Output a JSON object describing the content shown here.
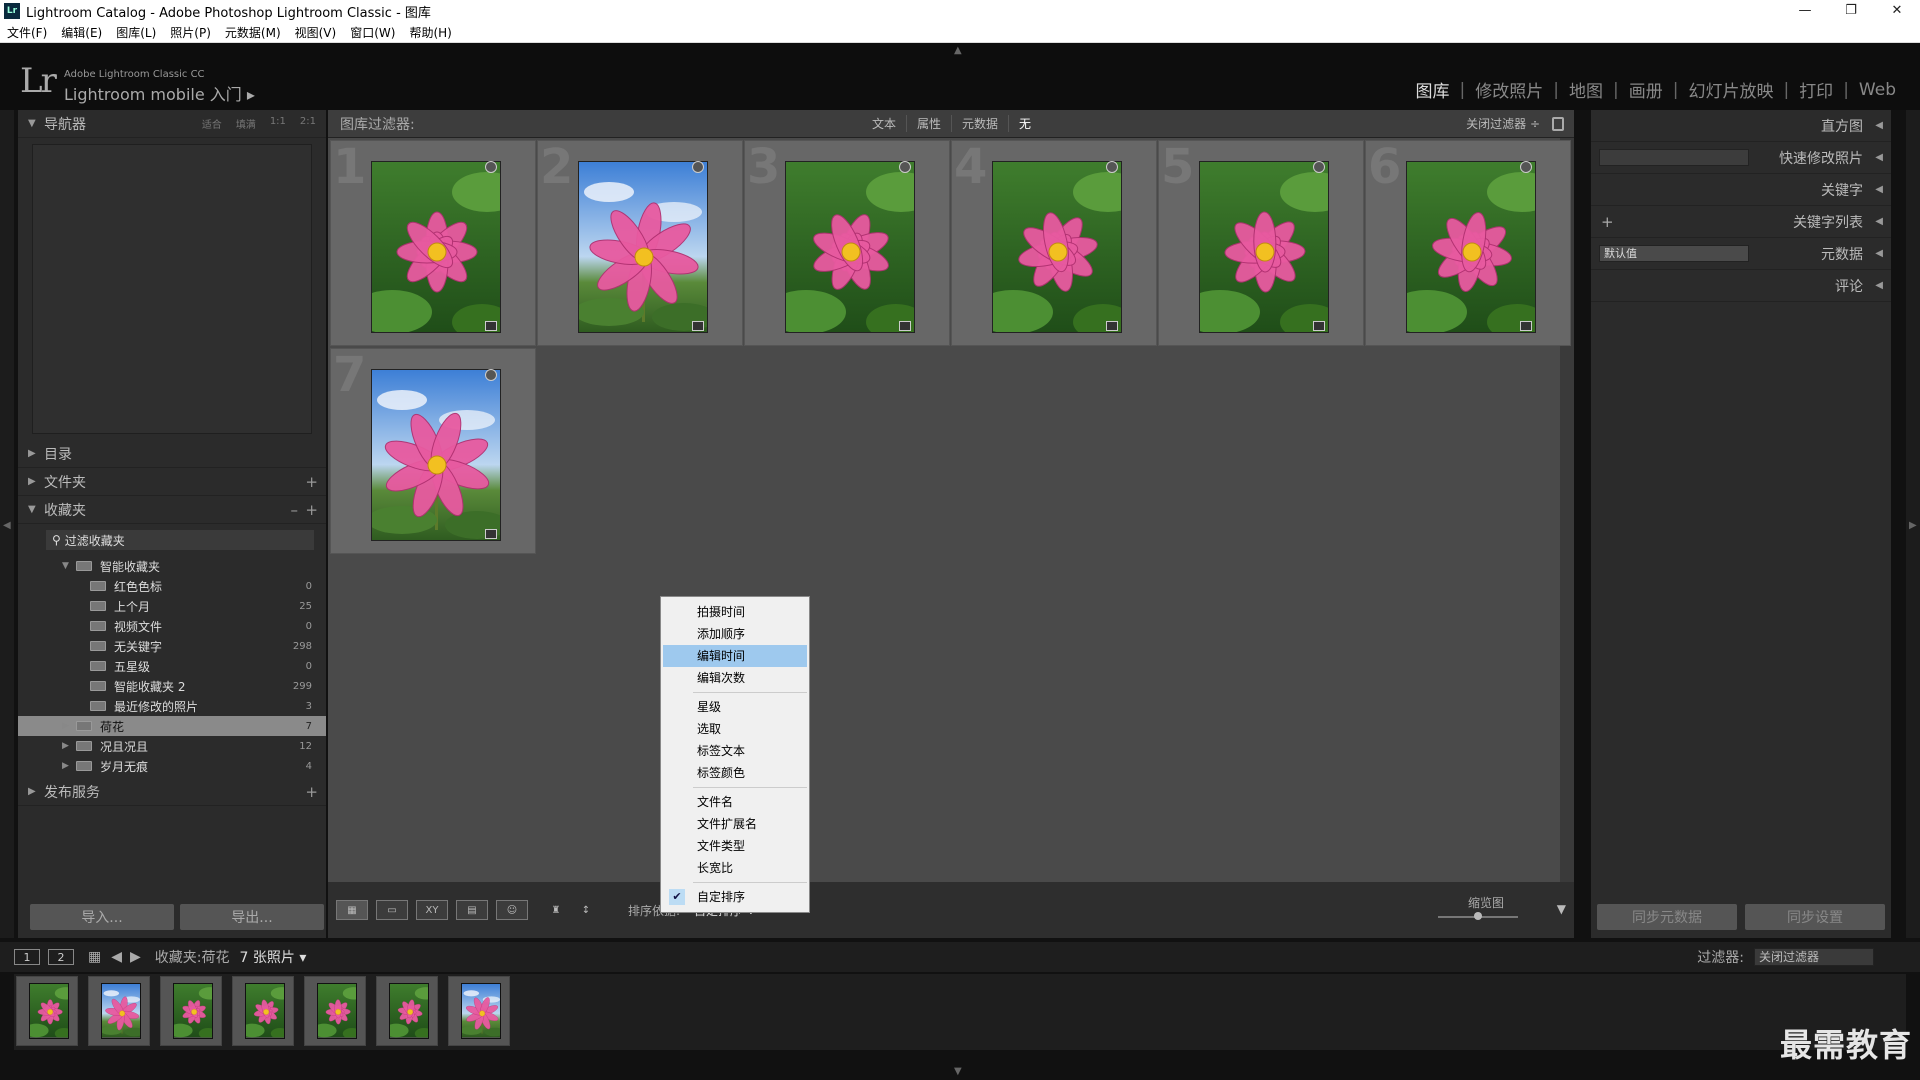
{
  "window": {
    "title": "Lightroom Catalog - Adobe Photoshop Lightroom Classic - 图库",
    "app_badge": "Lr",
    "controls": [
      "—",
      "❐",
      "✕"
    ]
  },
  "menubar": [
    "文件(F)",
    "编辑(E)",
    "图库(L)",
    "照片(P)",
    "元数据(M)",
    "视图(V)",
    "窗口(W)",
    "帮助(H)"
  ],
  "identity": {
    "logo": "Lr",
    "product": "Adobe Lightroom Classic CC",
    "tagline": "Lightroom mobile 入门 ▸"
  },
  "modules": [
    "图库",
    "修改照片",
    "地图",
    "画册",
    "幻灯片放映",
    "打印",
    "Web"
  ],
  "left_panel": {
    "navigator": {
      "title": "导航器",
      "zoom": [
        "适合",
        "填满",
        "1:1",
        "2:1"
      ]
    },
    "catalog": "目录",
    "folders": "文件夹",
    "collections": {
      "title": "收藏夹",
      "filter_placeholder": "过滤收藏夹",
      "smart_set": "智能收藏夹",
      "smart_items": [
        {
          "label": "红色色标",
          "count": "0"
        },
        {
          "label": "上个月",
          "count": "25"
        },
        {
          "label": "视频文件",
          "count": "0"
        },
        {
          "label": "无关键字",
          "count": "298"
        },
        {
          "label": "五星级",
          "count": "0"
        },
        {
          "label": "智能收藏夹 2",
          "count": "299"
        },
        {
          "label": "最近修改的照片",
          "count": "3"
        }
      ],
      "sets": [
        {
          "label": "荷花",
          "count": "7"
        },
        {
          "label": "况且况且",
          "count": "12"
        },
        {
          "label": "岁月无痕",
          "count": "4"
        }
      ]
    },
    "publish": "发布服务",
    "import_btn": "导入...",
    "export_btn": "导出..."
  },
  "filter_bar": {
    "label": "图库过滤器:",
    "tabs": [
      "文本",
      "属性",
      "元数据",
      "无"
    ],
    "close_filter": "关闭过滤器 ÷"
  },
  "grid": {
    "indices": [
      "1",
      "2",
      "3",
      "4",
      "5",
      "6",
      "7"
    ]
  },
  "toolbar": {
    "sort_label": "排序依据:",
    "sort_value": "自定排序 ÷",
    "thumb_label": "缩览图"
  },
  "sort_menu": {
    "groups": [
      [
        "拍摄时间",
        "添加顺序",
        "编辑时间",
        "编辑次数"
      ],
      [
        "星级",
        "选取",
        "标签文本",
        "标签颜色"
      ],
      [
        "文件名",
        "文件扩展名",
        "文件类型",
        "长宽比"
      ],
      [
        "自定排序"
      ]
    ],
    "highlighted": "编辑时间",
    "checked": "自定排序"
  },
  "right_panel": {
    "histogram": "直方图",
    "quick_develop": "快速修改照片",
    "keywording": "关键字",
    "keyword_list": "关键字列表",
    "metadata": "元数据",
    "metadata_preset": "默认值",
    "comments": "评论",
    "sync_metadata": "同步元数据",
    "sync_settings": "同步设置"
  },
  "filmstrip_bar": {
    "pages": [
      "1",
      "2"
    ],
    "source": "收藏夹:荷花",
    "count": "7 张照片 ▾",
    "filter_label": "过滤器:",
    "filter_value": "关闭过滤器"
  },
  "watermark": "最需教育",
  "colors": {
    "accent_highlight": "#9ec9ee",
    "panel_bg": "#2b2b2b",
    "grid_bg": "#4a4a4a",
    "cell_bg": "#676767",
    "selected_row": "#8a8a8a"
  }
}
